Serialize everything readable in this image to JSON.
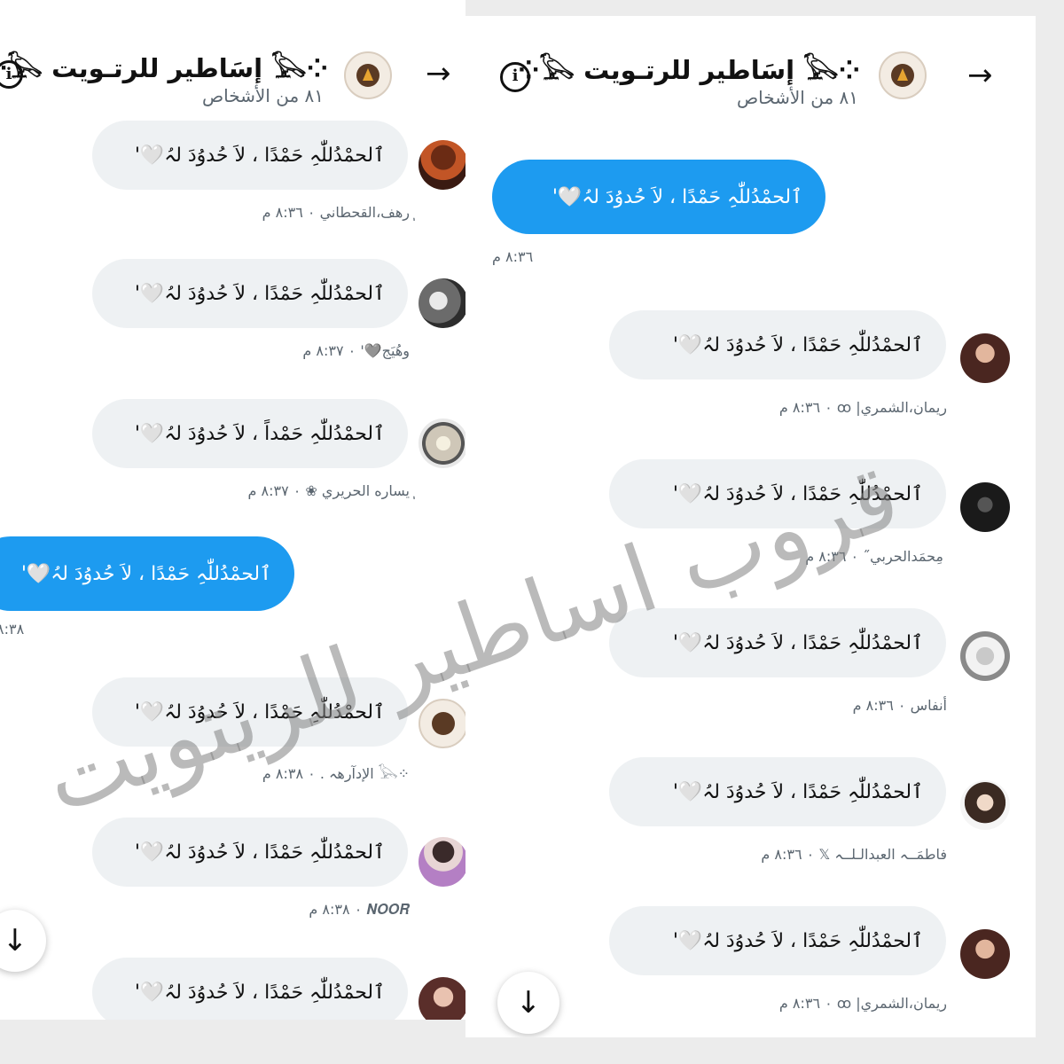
{
  "header": {
    "title": "⁘𓅂 إسَاطير للرتـويت 𓅂⁘",
    "subtitle": "٨١ من الأشخاص"
  },
  "message_text": "ٱلحمْدُللّٰہِ حَمْدًا ، لاَ حُدوُدَ لہُ🤍'",
  "left_panel": {
    "messages": [
      {
        "text": "ٱلحمْدُللّٰہِ حَمْدًا ، لاَ حُدوُدَ لہُ🤍'",
        "meta": "ٖرهف،القحطاني ٠ ٨:٣٦ م",
        "mine": false
      },
      {
        "text": "ٱلحمْدُللّٰہِ حَمْدًا ، لاَ حُدوُدَ لہُ🤍'",
        "meta": "وهُيَج🩶' ٠ ٨:٣٧ م",
        "mine": false
      },
      {
        "text": "ٱلحمْدُللّٰہِ حَمْداً ، لاَ حُدوُدَ لہُ🤍'",
        "meta": "ٖيساره الحريري ❀ ٠ ٨:٣٧ م",
        "mine": false
      },
      {
        "text": "ٱلحمْدُللّٰہِ حَمْدًا ، لاَ حُدوُدَ لہُ🤍'",
        "meta": "٨:٣٨",
        "mine": true
      },
      {
        "text": "ٱلحمْدُللّٰہِ حَمْدًا ، لاَ حُدوُدَ لہُ🤍'",
        "meta": "⁘𓅂 الإدآرهہ . ٠ ٨:٣٨ م",
        "mine": false
      },
      {
        "text": "ٱلحمْدُللّٰہِ حَمْدًا ، لاَ حُدوُدَ لہُ🤍'",
        "meta": "𝑵𝑶𝑶𝑹 ٠ ٨:٣٨ م",
        "mine": false
      },
      {
        "text": "ٱلحمْدُللّٰہِ حَمْدًا ، لاَ حُدوُدَ لہُ🤍'",
        "meta": "",
        "mine": false
      }
    ]
  },
  "right_panel": {
    "messages": [
      {
        "text": "ٱلحمْدُللّٰہِ حَمْدًا ، لاَ حُدوُدَ لہُ🤍'",
        "meta": "٨:٣٦ م",
        "mine": true
      },
      {
        "text": "ٱلحمْدُللّٰہِ حَمْدًا ، لاَ حُدوُدَ لہُ🤍'",
        "meta": "ريمان،الشمري| ꝏ ٠ ٨:٣٦ م",
        "mine": false
      },
      {
        "text": "ٱلحمْدُللّٰہِ حَمْدًا ، لاَ حُدوُدَ لہُ🤍'",
        "meta": "مِحمَدالحربي˝ ٠ ٨:٣٦ م",
        "mine": false
      },
      {
        "text": "ٱلحمْدُللّٰہِ حَمْدًا ، لاَ حُدوُدَ لہُ🤍'",
        "meta": "أنفاس ٠ ٨:٣٦ م",
        "mine": false
      },
      {
        "text": "ٱلحمْدُللّٰہِ حَمْدًا ، لاَ حُدوُدَ لہُ🤍'",
        "meta": "فاطمَــہ العبدالـلــہ 𝕏 ٠ ٨:٣٦ م",
        "mine": false
      },
      {
        "text": "ٱلحمْدُللّٰہِ حَمْدًا ، لاَ حُدوُدَ لہُ🤍'",
        "meta": "ريمان،الشمري| ꝏ ٠ ٨:٣٦ م",
        "mine": false
      }
    ]
  },
  "watermark": "قروب اساطير للريتويت",
  "icons": {
    "info": "i",
    "back_arrow": "→",
    "scroll_down": "↓"
  },
  "colors": {
    "accent": "#1d9bf0",
    "bubble_other": "#eef1f3",
    "meta_text": "#5b6670"
  }
}
